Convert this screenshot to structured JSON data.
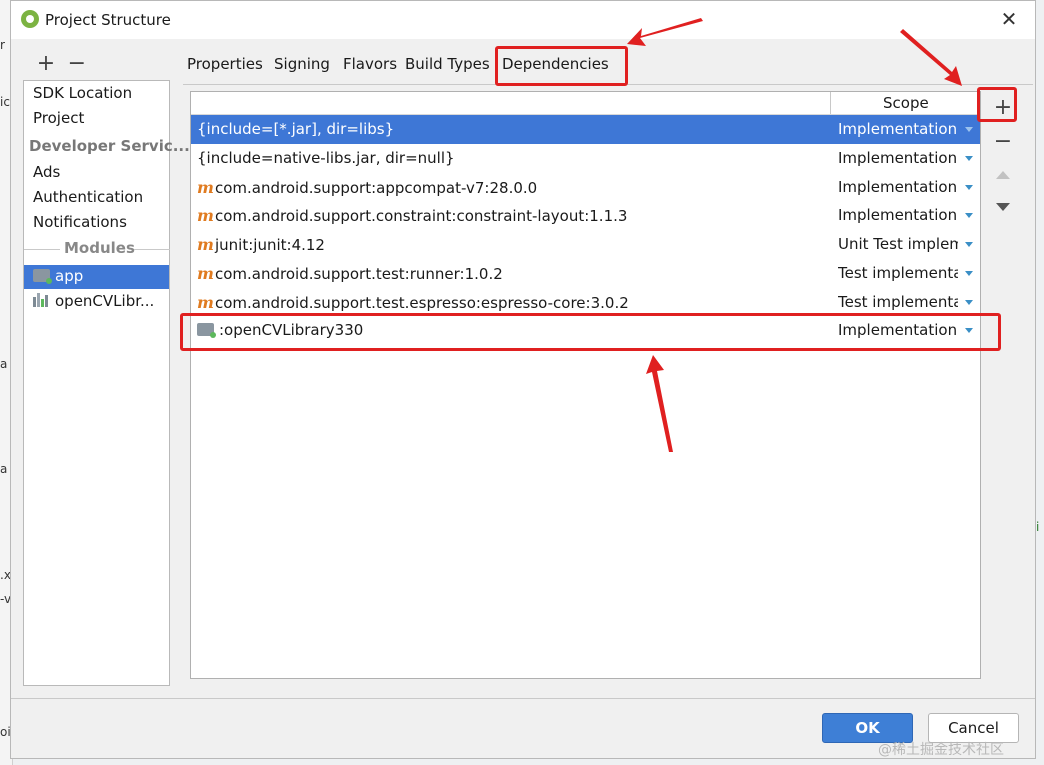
{
  "window": {
    "title": "Project Structure",
    "close_glyph": "✕"
  },
  "sidebar_toolbar": {
    "add": "+",
    "remove": "−"
  },
  "sidebar": {
    "items_top": [
      {
        "label": "SDK Location"
      },
      {
        "label": "Project"
      }
    ],
    "group_developer": "Developer Servic...",
    "items_dev": [
      {
        "label": "Ads"
      },
      {
        "label": "Authentication"
      },
      {
        "label": "Notifications"
      }
    ],
    "modules_label": "Modules",
    "modules": [
      {
        "label": "app",
        "selected": true,
        "icon": "module-folder-icon"
      },
      {
        "label": "openCVLibr...",
        "selected": false,
        "icon": "library-module-icon"
      }
    ]
  },
  "tabs": [
    {
      "label": "Properties"
    },
    {
      "label": "Signing"
    },
    {
      "label": "Flavors"
    },
    {
      "label": "Build Types"
    },
    {
      "label": "Dependencies",
      "active": true
    }
  ],
  "table": {
    "scope_header": "Scope",
    "rows": [
      {
        "icon": "",
        "name": "{include=[*.jar], dir=libs}",
        "scope": "Implementation",
        "selected": true
      },
      {
        "icon": "",
        "name": "{include=native-libs.jar, dir=null}",
        "scope": "Implementation"
      },
      {
        "icon": "m",
        "name": "com.android.support:appcompat-v7:28.0.0",
        "scope": "Implementation"
      },
      {
        "icon": "m",
        "name": "com.android.support.constraint:constraint-layout:1.1.3",
        "scope": "Implementation"
      },
      {
        "icon": "m",
        "name": "junit:junit:4.12",
        "scope": "Unit Test implem..."
      },
      {
        "icon": "m",
        "name": "com.android.support.test:runner:1.0.2",
        "scope": "Test implementa..."
      },
      {
        "icon": "m",
        "name": "com.android.support.test.espresso:espresso-core:3.0.2",
        "scope": "Test implementa..."
      },
      {
        "icon": "folder",
        "name": ":openCVLibrary330",
        "scope": "Implementation"
      }
    ]
  },
  "side_tools": {
    "add": "+",
    "remove": "−"
  },
  "buttons": {
    "ok": "OK",
    "cancel": "Cancel"
  },
  "watermark": "@稀土掘金技术社区",
  "annotation_color": "#e02020"
}
